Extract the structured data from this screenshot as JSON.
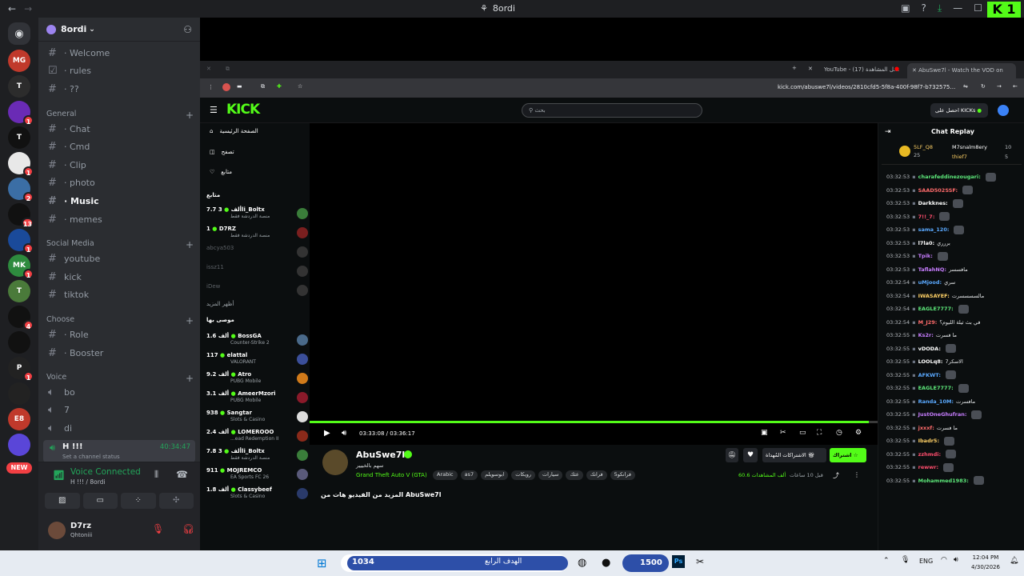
{
  "titlebar": {
    "title": "8ordi"
  },
  "brand": {
    "kick_tag": "K 1"
  },
  "server_badges": [
    "1",
    "1",
    "2",
    "13",
    "1",
    "1",
    "4",
    "1"
  ],
  "server_abbrevs": [
    "MG",
    "T",
    "",
    "T",
    "",
    "",
    "",
    "",
    "MK",
    "T",
    "",
    "",
    "P",
    "",
    "E8",
    "",
    "",
    ""
  ],
  "new_label": "NEW",
  "server": {
    "name": "8ordi"
  },
  "channels": {
    "top": [
      {
        "label": "· Welcome"
      },
      {
        "label": "· rules"
      },
      {
        "label": "· ??"
      }
    ],
    "categories": [
      {
        "name": "General",
        "items": [
          "· Chat",
          "· Cmd",
          "· Clip",
          "· photo",
          "· Music",
          "· memes"
        ]
      },
      {
        "name": "Social Media",
        "items": [
          "youtube",
          "kick",
          "tiktok"
        ]
      },
      {
        "name": "Choose",
        "items": [
          "· Role",
          "· Booster"
        ]
      },
      {
        "name": "Voice",
        "items": [
          "bo",
          "7",
          "di",
          "H !!!"
        ]
      }
    ],
    "active_voice": {
      "name": "H !!!",
      "time": "40:34:47",
      "status": "Set a channel status"
    }
  },
  "voice_panel": {
    "status": "Voice Connected",
    "location": "H !!! / 8ordi"
  },
  "user": {
    "name": "D7rz",
    "status": "Qhtoniii"
  },
  "browser": {
    "tabs": [
      "YouTube - سجل المشاهدة (17)",
      "AbuSwe7l - Watch the VOD on"
    ],
    "url": "kick.com/abuswe7l/videos/2810cfd5-5f8a-400f-98f7-b7325758860"
  },
  "kick": {
    "logo": "KICK",
    "search_placeholder": "بحث",
    "get_kicks": "احصل على KICKs",
    "nav": [
      "الصفحة الرئيسية",
      "تصفح",
      "متابع"
    ],
    "following_header": "متابع",
    "following": [
      {
        "name": "3li_Boltx",
        "count": "7.7 ألف",
        "game": "منصة الدردشة فقط",
        "color": "#3a7d3a"
      },
      {
        "name": "D7RZ",
        "count": "1",
        "game": "منصة الدردشة فقط",
        "color": "#7a1f1f"
      },
      {
        "name": "abcya503",
        "count": "",
        "game": "",
        "color": "#333"
      },
      {
        "name": "issz11",
        "count": "",
        "game": "",
        "color": "#333"
      },
      {
        "name": "iDew",
        "count": "",
        "game": "",
        "color": "#333"
      }
    ],
    "show_more": "أظهر المزيد",
    "recommended_header": "موصى بها",
    "recommended": [
      {
        "name": "BossGA",
        "count": "1.6 ألف",
        "game": "Counter-Strike 2",
        "color": "#4a6a8a"
      },
      {
        "name": "elattal",
        "count": "117",
        "game": "VALORANT",
        "color": "#3b4f9a"
      },
      {
        "name": "Atro",
        "count": "9.2 ألف",
        "game": "PUBG Mobile",
        "color": "#d07a1a"
      },
      {
        "name": "AmeerMzori",
        "count": "3.1 ألف",
        "game": "PUBG Mobile",
        "color": "#8a1a2a"
      },
      {
        "name": "Sangtar",
        "count": "938",
        "game": "Slots & Casino",
        "color": "#ddd"
      },
      {
        "name": "LOMEROOO",
        "count": "2.4 ألف",
        "game": "...ead Redemption II",
        "color": "#8a2a1a"
      },
      {
        "name": "3li_Boltx",
        "count": "7.8 ألف",
        "game": "منصة الدردشة فقط",
        "color": "#3a7d3a"
      },
      {
        "name": "MOJREMCO",
        "count": "911",
        "game": "EA Sports FC 26",
        "color": "#5a5a7a"
      },
      {
        "name": "Classybeef",
        "count": "1.8 ألف",
        "game": "Slots & Casino",
        "color": "#2a3a6a"
      }
    ],
    "player": {
      "time": "03:33:08 / 03:36:17",
      "progress": 0.985
    },
    "channel": {
      "name": "AbuSwe7l",
      "subtitle": "سهم بالخييير",
      "category": "Grand Theft Auto V (GTA)",
      "tags": [
        "Arabic",
        "as7",
        "ابوسويلم",
        "رويكات",
        "سيارات",
        "عثك",
        "فرانك",
        "فرانكو5"
      ],
      "subscribe": "اشتراك",
      "gift": "الاشتراكات المُهداة",
      "views": "60.6 ألف المشاهدات",
      "ago": "قبل 10 ساعات",
      "more": "المزيد من الفيديو هات من AbuSwe7l"
    },
    "chat": {
      "title": "Chat Replay",
      "leaders": [
        {
          "name": "5LF_Q8",
          "val": "25"
        },
        {
          "name": "M7snalm8ery",
          "val": "10"
        },
        {
          "name": "thief7",
          "val": "5"
        }
      ],
      "messages": [
        {
          "time": "03:32:53",
          "user": "charafeddinezougari:",
          "text": "",
          "color": "#5de87a"
        },
        {
          "time": "03:32:53",
          "user": "SAAD502SSF:",
          "text": "",
          "color": "#ff6b6b"
        },
        {
          "time": "03:32:53",
          "user": "Darkknes:",
          "text": "",
          "color": "#ffffff"
        },
        {
          "time": "03:32:53",
          "user": "7!!_7:",
          "text": "",
          "color": "#ff4d6d"
        },
        {
          "time": "03:32:53",
          "user": "sama_120:",
          "text": "",
          "color": "#5aa9ff"
        },
        {
          "time": "03:32:53",
          "user": "l7la0:",
          "text": "بررري",
          "color": "#ffffff"
        },
        {
          "time": "03:32:53",
          "user": "Tpik:",
          "text": "",
          "color": "#c77dff"
        },
        {
          "time": "03:32:53",
          "user": "TaflahNQ:",
          "text": "مافسسر",
          "color": "#c77dff"
        },
        {
          "time": "03:32:54",
          "user": "uMjood:",
          "text": "سري",
          "color": "#5aa9ff"
        },
        {
          "time": "03:32:54",
          "user": "IWASAYEF:",
          "text": "مالسسسسرت",
          "color": "#ffd166"
        },
        {
          "time": "03:32:54",
          "user": "EAGLE7777:",
          "text": "",
          "color": "#5de87a"
        },
        {
          "time": "03:32:54",
          "user": "M_J29:",
          "text": "في بث ثيلة الليوم؟",
          "color": "#ff6b6b"
        },
        {
          "time": "03:32:55",
          "user": "Ks2r:",
          "text": "ما فسرت",
          "color": "#c77dff"
        },
        {
          "time": "03:32:55",
          "user": "vDODA:",
          "text": "",
          "color": "#ffffff"
        },
        {
          "time": "03:32:55",
          "user": "LOOLq8:",
          "text": "7الاسكر",
          "color": "#ffffff"
        },
        {
          "time": "03:32:55",
          "user": "AFKWT:",
          "text": "",
          "color": "#5aa9ff"
        },
        {
          "time": "03:32:55",
          "user": "EAGLE7777:",
          "text": "",
          "color": "#5de87a"
        },
        {
          "time": "03:32:55",
          "user": "Randa_10M:",
          "text": "مافسرت",
          "color": "#5aa9ff"
        },
        {
          "time": "03:32:55",
          "user": "JustOneGhufran:",
          "text": "",
          "color": "#c77dff"
        },
        {
          "time": "03:32:55",
          "user": "jxxxf:",
          "text": "ما فسرت",
          "color": "#ff6b6b"
        },
        {
          "time": "03:32:55",
          "user": "Ibadr5:",
          "text": "",
          "color": "#ffd166"
        },
        {
          "time": "03:32:55",
          "user": "zzhmdi:",
          "text": "",
          "color": "#ff4d6d"
        },
        {
          "time": "03:32:55",
          "user": "rewwr:",
          "text": "",
          "color": "#ff4d6d"
        },
        {
          "time": "03:32:55",
          "user": "Mohammed1983:",
          "text": "",
          "color": "#5de87a"
        }
      ]
    }
  },
  "taskbar": {
    "search_left": "1034",
    "search_mid": "الهدف الرابع",
    "search_right": "1500",
    "lang": "ENG",
    "time": "12:04 PM",
    "date": "4/30/2026"
  },
  "colors": {
    "kick_green": "#53fc18",
    "discord_bg": "#2b2d31",
    "rail_bg": "#1e1f22",
    "voice_green": "#23a55a"
  }
}
